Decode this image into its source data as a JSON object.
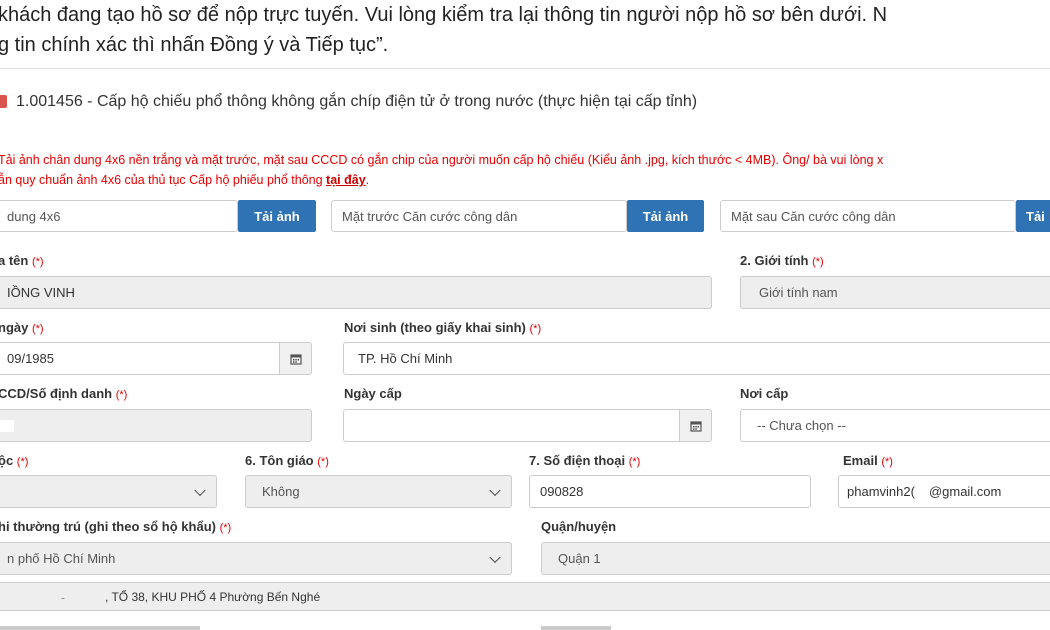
{
  "intro": {
    "line1": "khách đang tạo hồ sơ để nộp trực tuyến. Vui lòng kiểm tra lại thông tin người nộp hồ sơ bên dưới. N",
    "line2": "g tin chính xác thì nhấn Đồng ý và Tiếp tục”."
  },
  "procedure": {
    "code": "1.001456",
    "separator": " - ",
    "name": "Cấp hộ chiếu phổ thông không gắn chíp điện tử ở trong nước (thực hiện tại cấp tỉnh)"
  },
  "notice": {
    "line1": "Tải ảnh chân dung 4x6 nền trắng và mặt trước, mặt sau CCCD có gắn chip của người muốn cấp hộ chiếu (Kiểu ảnh .jpg, kích thước < 4MB). Ông/ bà vui lòng x",
    "line2_prefix": "ẫn quy chuẩn ảnh 4x6 của thủ tục Cấp hộ phiếu phổ thông ",
    "link": "tại đây",
    "line2_suffix": "."
  },
  "uploads": {
    "portrait_placeholder": "dung 4x6",
    "front_placeholder": "Mặt trước Căn cước công dân",
    "back_placeholder": "Mặt sau Căn cước công dân",
    "btn1": "Tải ảnh",
    "btn2": "Tải ảnh",
    "btn3": "Tải"
  },
  "required_mark": "(*)",
  "fields": {
    "fullname": {
      "label": "a tên",
      "value": "IỒNG VINH"
    },
    "gender": {
      "label": "2. Giới tính",
      "value": "Giới tính nam"
    },
    "dob": {
      "label": "ngày",
      "value": "09/1985"
    },
    "birthplace": {
      "label": "Nơi sinh (theo giấy khai sinh)",
      "value": "TP. Hồ Chí Minh"
    },
    "id_number": {
      "label": "CCD/Số định danh",
      "value": ""
    },
    "issue_date": {
      "label": "Ngày cấp",
      "value": ""
    },
    "issue_place": {
      "label": "Nơi cấp",
      "value": "-- Chưa chọn --"
    },
    "ethnicity": {
      "label": "ộc",
      "value": ""
    },
    "religion": {
      "label": "6. Tôn giáo",
      "value": "Không"
    },
    "phone": {
      "label": "7. Số điện thoại",
      "value": "090828"
    },
    "email": {
      "label": "Email",
      "value_start": "phamvinh2(",
      "value_end": "@gmail.com"
    },
    "residence": {
      "label": "hi thường trú (ghi theo sổ hộ khẩu)",
      "value": "n phố Hồ Chí Minh"
    },
    "district": {
      "label": "Quận/huyện",
      "value": "Quận 1"
    },
    "address": {
      "value_prefix": "-",
      "value": ", TỔ 38, KHU PHỐ 4 Phường Bến Nghé"
    }
  },
  "icons": {
    "calendar": "calendar-icon",
    "chevron": "chevron-down-icon",
    "procedure": "document-icon"
  },
  "colors": {
    "primary": "#2f73b4",
    "required": "#e60000",
    "readonly_bg": "#eeeeee"
  }
}
